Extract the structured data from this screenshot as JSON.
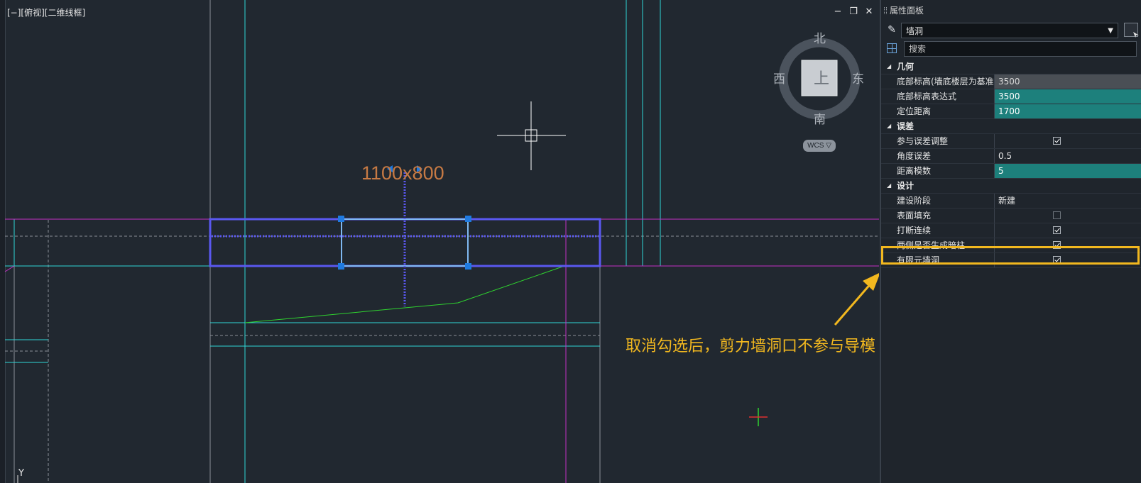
{
  "viewport": {
    "view_label": "[−][俯视][二维线框]",
    "window_controls": [
      "−",
      "❐",
      "✕"
    ],
    "dimension_text": "1100x800",
    "axis_label": "Y",
    "annotation": "取消勾选后，剪力墙洞口不参与导模"
  },
  "compass": {
    "north": "北",
    "south": "南",
    "east": "东",
    "west": "西",
    "center": "上",
    "wcs_label": "WCS ▽"
  },
  "panel": {
    "title": "属性面板",
    "type_icon": "pencil-icon",
    "type_value": "墙洞",
    "search_placeholder": "搜索",
    "sections": [
      {
        "name": "几何",
        "rows": [
          {
            "label": "底部标高(墙底楼层为基准)",
            "value": "3500",
            "style": "gray"
          },
          {
            "label": "底部标高表达式",
            "value": "3500",
            "style": "teal"
          },
          {
            "label": "定位距离",
            "value": "1700",
            "style": "teal"
          }
        ]
      },
      {
        "name": "误差",
        "rows": [
          {
            "label": "参与误差调整",
            "checkbox": true
          },
          {
            "label": "角度误差",
            "value": "0.5",
            "style": "plain"
          },
          {
            "label": "距离模数",
            "value": "5",
            "style": "teal"
          }
        ]
      },
      {
        "name": "设计",
        "rows": [
          {
            "label": "建设阶段",
            "value": "新建",
            "style": "plain"
          },
          {
            "label": "表面填充",
            "checkbox": false
          },
          {
            "label": "打断连续",
            "checkbox": true
          },
          {
            "label": "两侧是否生成暗柱",
            "checkbox": true
          },
          {
            "label": "有限元墙洞",
            "checkbox": true
          }
        ]
      }
    ]
  },
  "colors": {
    "background": "#212830",
    "cyan_line": "#2fd6d6",
    "magenta_line": "#c32fc3",
    "selection_blue": "#5a58f0",
    "grip_blue": "#1f7ae0",
    "green_line": "#2fd42f",
    "highlight": "#f2b81f",
    "teal_value": "#1d807c"
  }
}
